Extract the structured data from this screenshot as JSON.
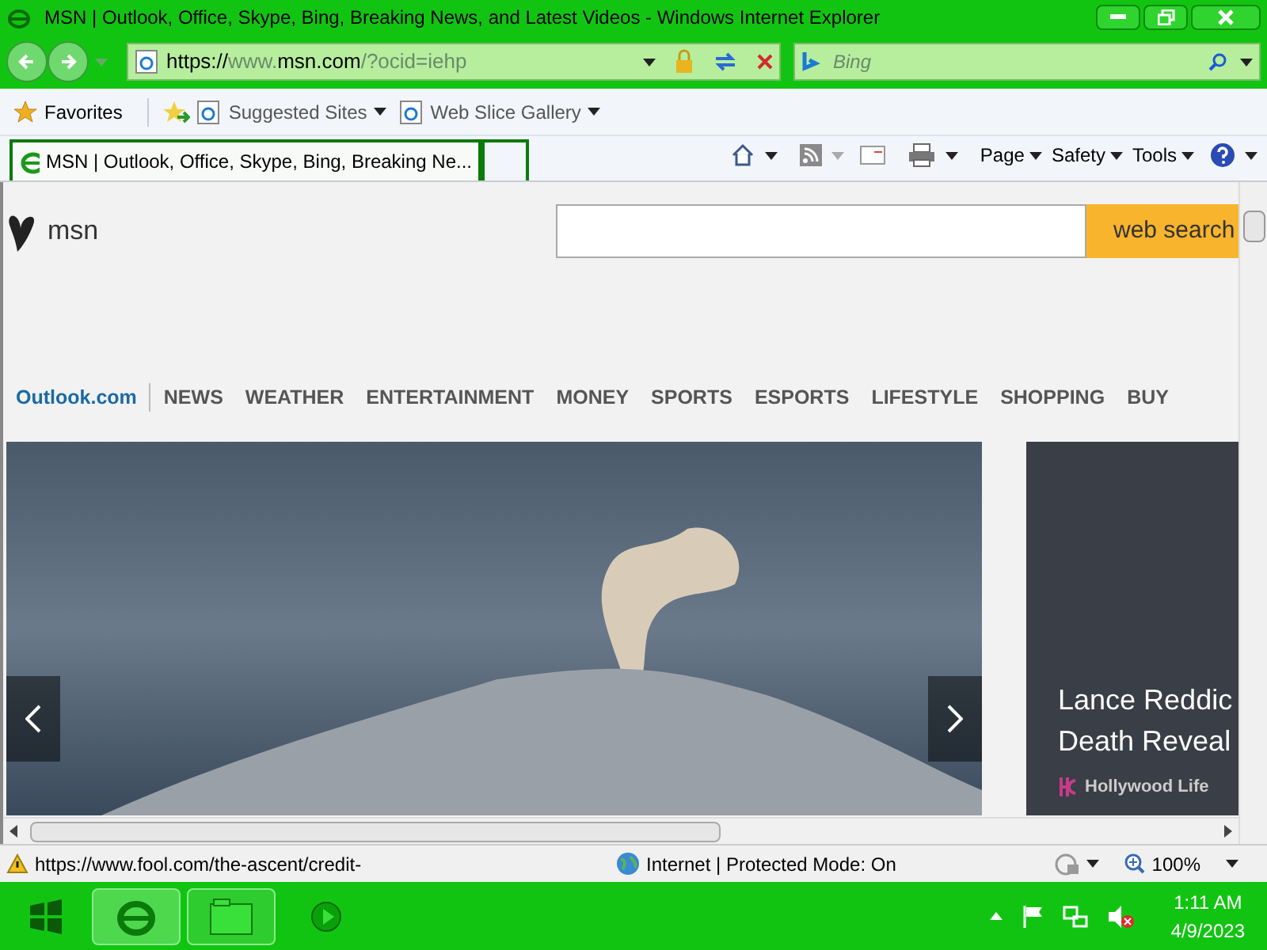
{
  "window": {
    "title": "MSN | Outlook, Office, Skype, Bing, Breaking News, and Latest Videos - Windows Internet Explorer"
  },
  "address": {
    "parts": [
      {
        "text": "https://",
        "dimmed": false
      },
      {
        "text": "www.",
        "dimmed": true
      },
      {
        "text": "msn.com",
        "dimmed": false
      },
      {
        "text": "/?ocid=iehp",
        "dimmed": true
      }
    ]
  },
  "search": {
    "placeholder": "Bing"
  },
  "favorites_bar": {
    "label": "Favorites",
    "links": [
      "Suggested Sites",
      "Web Slice Gallery"
    ]
  },
  "tabs": [
    {
      "title": "MSN | Outlook, Office, Skype, Bing, Breaking Ne...",
      "selected": true
    }
  ],
  "command_bar": [
    "Page",
    "Safety",
    "Tools"
  ],
  "page": {
    "logo": "msn",
    "search_button": "web search",
    "nav": [
      {
        "label": "Outlook.com",
        "kind": "brand"
      },
      {
        "label": "NEWS",
        "kind": "section"
      },
      {
        "label": "WEATHER",
        "kind": "section"
      },
      {
        "label": "ENTERTAINMENT",
        "kind": "section"
      },
      {
        "label": "MONEY",
        "kind": "section"
      },
      {
        "label": "SPORTS",
        "kind": "section"
      },
      {
        "label": "ESPORTS",
        "kind": "section"
      },
      {
        "label": "LIFESTYLE",
        "kind": "section"
      },
      {
        "label": "SHOPPING",
        "kind": "section"
      },
      {
        "label": "BUY",
        "kind": "section"
      }
    ],
    "side_card": {
      "headline_lines": [
        "Lance Reddic",
        "Death Reveal"
      ],
      "source": "Hollywood Life"
    }
  },
  "status_bar": {
    "url": "https://www.fool.com/the-ascent/credit-",
    "zone": "Internet | Protected Mode: On",
    "zoom": "100%"
  },
  "taskbar": {
    "time": "1:11 AM",
    "date": "4/9/2023"
  }
}
